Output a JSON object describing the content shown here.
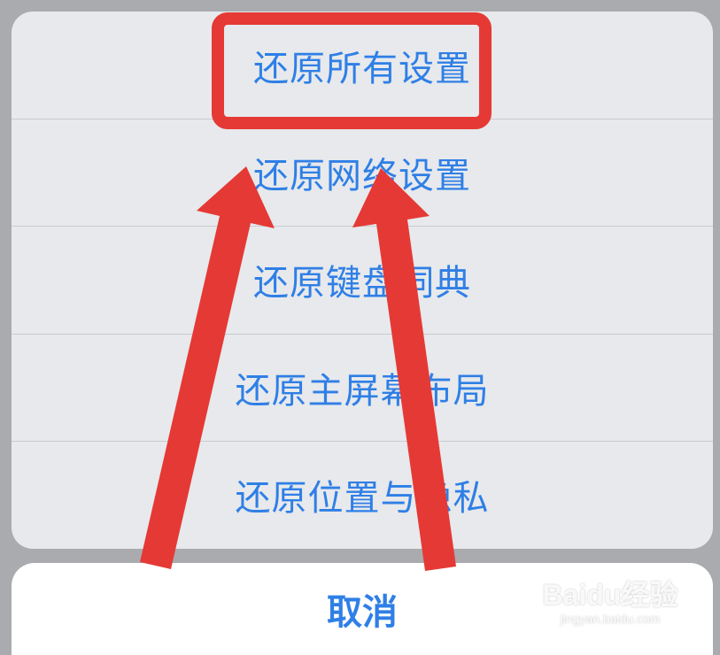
{
  "reset_sheet": {
    "options": [
      {
        "label": "还原所有设置"
      },
      {
        "label": "还原网络设置"
      },
      {
        "label": "还原键盘词典"
      },
      {
        "label": "还原主屏幕布局"
      },
      {
        "label": "还原位置与隐私"
      }
    ],
    "cancel_label": "取消"
  },
  "annotation": {
    "highlight_color": "#e53935",
    "arrow_color": "#e53935"
  },
  "watermark": {
    "brand": "Baidu经验",
    "url": "jingyan.baidu.com"
  },
  "colors": {
    "action_text": "#2f7fe6",
    "sheet_background": "#e7e9ec",
    "cancel_background": "#ffffff",
    "backdrop": "#a9abae"
  }
}
